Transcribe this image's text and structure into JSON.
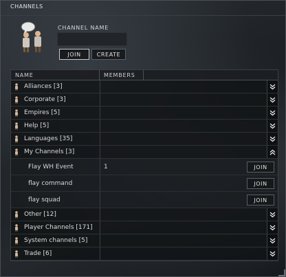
{
  "window": {
    "title": "CHANNELS"
  },
  "header": {
    "channel_name_label": "CHANNEL NAME",
    "channel_name_value": "",
    "join_label": "JOIN",
    "create_label": "CREATE"
  },
  "table": {
    "col_name": "NAME",
    "col_members": "MEMBERS"
  },
  "groups": [
    {
      "label": "Alliances [3]",
      "expanded": false
    },
    {
      "label": "Corporate [3]",
      "expanded": false
    },
    {
      "label": "Empires [5]",
      "expanded": false
    },
    {
      "label": "Help [5]",
      "expanded": false
    },
    {
      "label": "Languages [35]",
      "expanded": false
    },
    {
      "label": "My Channels [3]",
      "expanded": true
    },
    {
      "label": "Other [12]",
      "expanded": false
    },
    {
      "label": "Player Channels [171]",
      "expanded": false
    },
    {
      "label": "System channels [5]",
      "expanded": false
    },
    {
      "label": "Trade [6]",
      "expanded": false
    }
  ],
  "my_channels": [
    {
      "name": "Flay WH Event",
      "members": "1",
      "join_label": "JOIN"
    },
    {
      "name": "flay command",
      "members": "",
      "join_label": "JOIN"
    },
    {
      "name": "flay squad",
      "members": "",
      "join_label": "JOIN"
    }
  ],
  "colors": {
    "text": "#d6d6d6",
    "border": "#4a5056",
    "button_border_active": "#c8c8c8",
    "person_icon": "#c8a27a"
  }
}
